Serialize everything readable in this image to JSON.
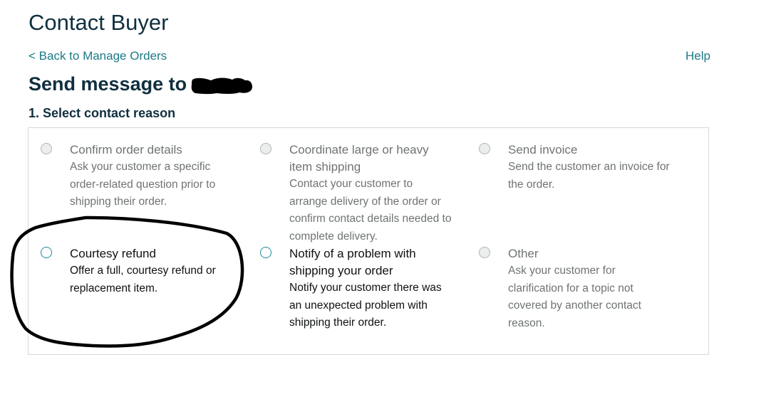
{
  "page": {
    "title": "Contact Buyer",
    "back_link": "< Back to Manage Orders",
    "help_link": "Help",
    "send_to_label": "Send message to",
    "step_title": "1. Select contact reason"
  },
  "colors": {
    "link": "#1b7a86",
    "radio_enabled": "#1b8a9a",
    "heading": "#0f2f3f"
  },
  "options": [
    {
      "title": "Confirm order details",
      "description": "Ask your customer a specific order-related question prior to shipping their order.",
      "state": "disabled"
    },
    {
      "title": "Coordinate large or heavy item shipping",
      "description": "Contact your customer to arrange delivery of the order or confirm contact details needed to complete delivery.",
      "state": "disabled"
    },
    {
      "title": "Send invoice",
      "description": "Send the customer an invoice for the order.",
      "state": "disabled"
    },
    {
      "title": "Courtesy refund",
      "description": "Offer a full, courtesy refund or replacement item.",
      "state": "enabled"
    },
    {
      "title": "Notify of a problem with shipping your order",
      "description": "Notify your customer there was an unexpected problem with shipping their order.",
      "state": "enabled"
    },
    {
      "title": "Other",
      "description": "Ask your customer for clarification for a topic not covered by another contact reason.",
      "state": "disabled"
    }
  ]
}
